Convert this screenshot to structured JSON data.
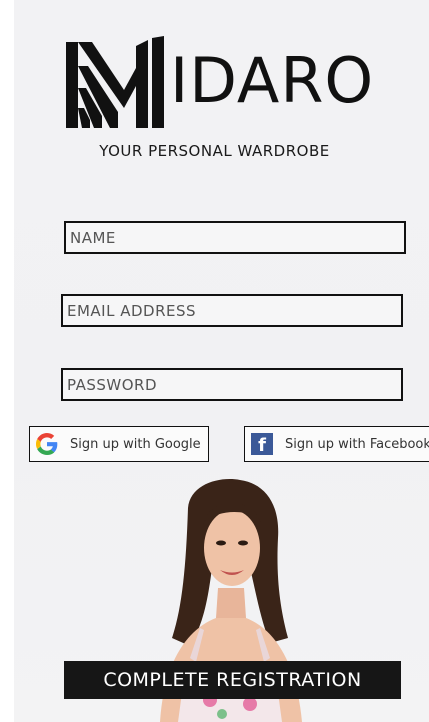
{
  "brand": {
    "logo_text": "IDARO",
    "tagline": "YOUR PERSONAL WARDROBE"
  },
  "form": {
    "name_placeholder": "NAME",
    "email_placeholder": "EMAIL ADDRESS",
    "password_placeholder": "PASSWORD"
  },
  "social": {
    "google_label": "Sign up with Google",
    "facebook_label": "Sign up with Facebook",
    "google_icon": "google-g-icon",
    "facebook_icon": "facebook-f-icon"
  },
  "submit_label": "COMPLETE REGISTRATION",
  "colors": {
    "primary": "#161616",
    "facebook": "#3b5998",
    "background": "#f2f2f4"
  }
}
